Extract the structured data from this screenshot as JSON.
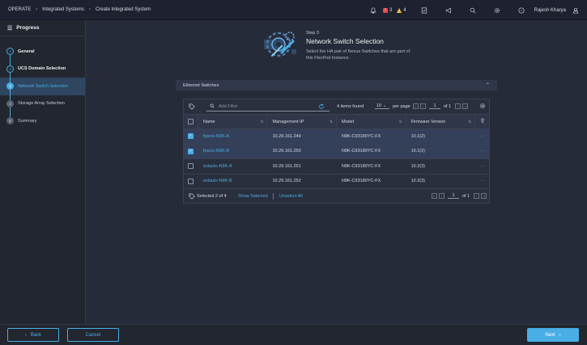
{
  "topbar": {
    "breadcrumbs": [
      "OPERATE",
      "Integrated Systems",
      "Create Integrated System"
    ],
    "alerts_critical": "3",
    "alerts_warning": "4",
    "user_name": "Rajesh Kharya"
  },
  "sidebar": {
    "title": "Progress",
    "steps": [
      {
        "num": "1",
        "label": "General",
        "state": "done"
      },
      {
        "num": "2",
        "label": "UCS Domain Selection",
        "state": "done"
      },
      {
        "num": "3",
        "label": "Network Switch Selection",
        "state": "active"
      },
      {
        "num": "4",
        "label": "Storage Array Selection",
        "state": "pending"
      },
      {
        "num": "5",
        "label": "Summary",
        "state": "pending"
      }
    ]
  },
  "header": {
    "step_number": "Step 3",
    "title": "Network Switch Selection",
    "description": "Select the HA pair of Nexus Switches that are part of this FlexPod Instance."
  },
  "section": {
    "title": "Ethernet Switches"
  },
  "table_toolbar": {
    "filter_placeholder": "Add Filter",
    "items_found": "4 items found",
    "per_page_value": "10",
    "per_page_label": "per page",
    "page": "1",
    "of_pages": "of 1"
  },
  "table": {
    "columns": [
      "Name",
      "Management IP",
      "Model",
      "Firmware Version"
    ],
    "rows": [
      {
        "name": "fpscis-N9K-A",
        "ip": "10.29.161.249",
        "model": "N9K-C93180YC-FX",
        "firmware": "10.1(2)",
        "selected": true
      },
      {
        "name": "fpscis-N9K-B",
        "ip": "10.29.161.250",
        "model": "N9K-C93180YC-FX",
        "firmware": "10.1(2)",
        "selected": true
      },
      {
        "name": "solauto-N9K-A",
        "ip": "10.29.161.251",
        "model": "N9K-C93180YC-FX",
        "firmware": "10.2(3)",
        "selected": false
      },
      {
        "name": "solauto-N9K-B",
        "ip": "10.29.161.252",
        "model": "N9K-C93180YC-FX",
        "firmware": "10.2(3)",
        "selected": false
      }
    ]
  },
  "table_footer": {
    "selected_count": "Selected 2 of 4",
    "show_selected": "Show Selected",
    "unselect_all": "Unselect All",
    "page": "1",
    "of_pages": "of 1"
  },
  "footer": {
    "back_label": "Back",
    "cancel_label": "Cancel",
    "next_label": "Next"
  },
  "colors": {
    "accent": "#49aee6",
    "background": "#262b39",
    "critical": "#e0474c",
    "warning": "#f5c342"
  }
}
